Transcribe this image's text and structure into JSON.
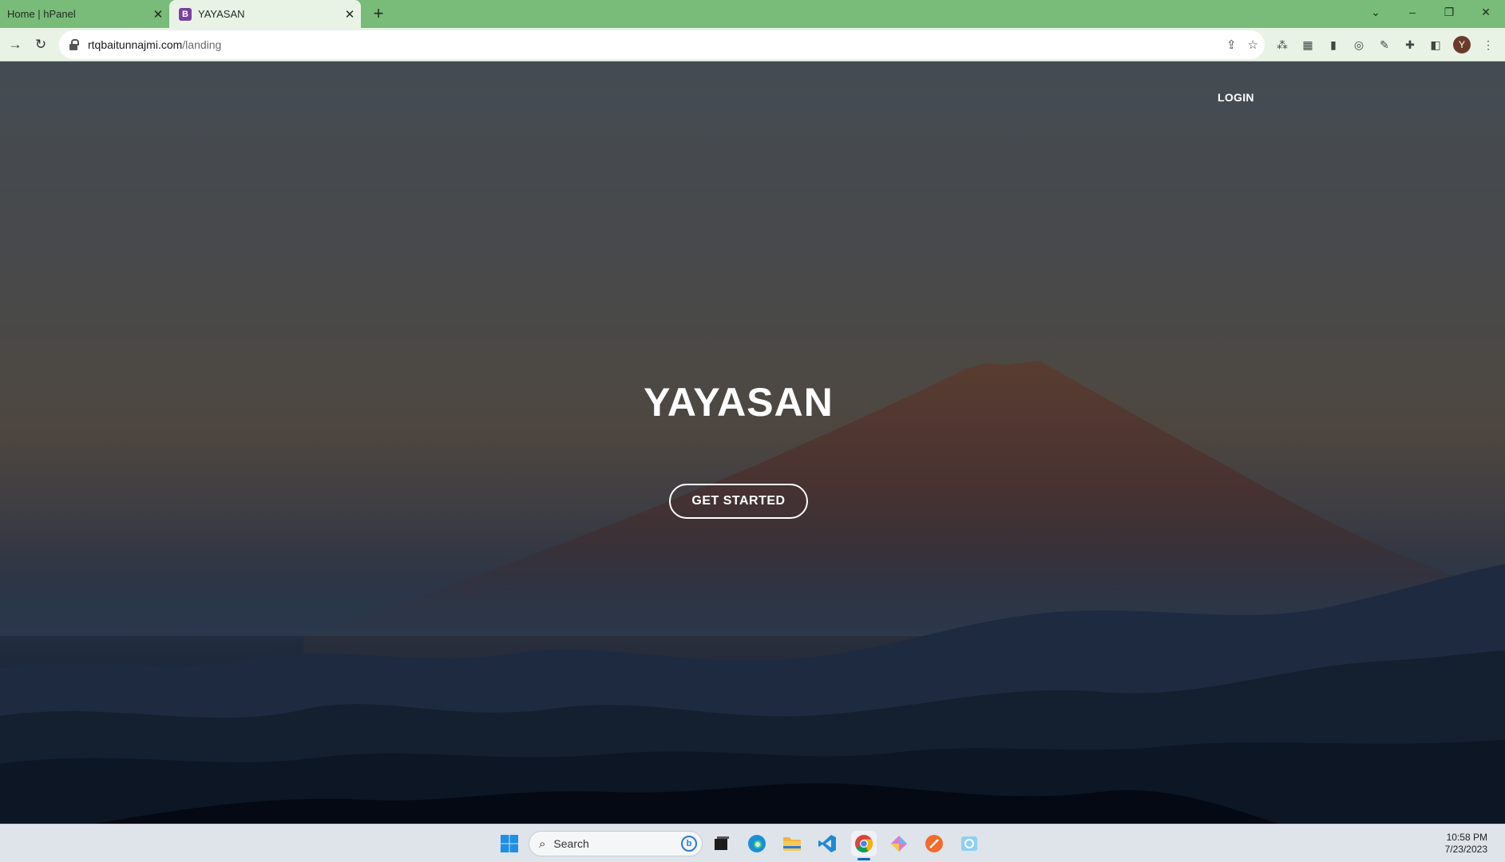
{
  "browser": {
    "tabs": [
      {
        "title": "Home | hPanel",
        "active": false
      },
      {
        "title": "YAYASAN",
        "active": true,
        "favicon": "B"
      }
    ],
    "close_glyph": "✕",
    "new_tab_glyph": "+",
    "url_host": "rtqbaitunnajmi.com",
    "url_path": "/landing",
    "profile_initial": "Y",
    "window_controls": {
      "dropdown": "⌄",
      "minimize": "–",
      "restore": "❐",
      "close": "✕"
    }
  },
  "page": {
    "nav": {
      "login": "LOGIN"
    },
    "hero": {
      "title": "YAYASAN",
      "cta": "GET STARTED"
    }
  },
  "taskbar": {
    "search_placeholder": "Search",
    "time": "10:58 PM",
    "date": "7/23/2023",
    "apps": [
      "windows-start",
      "task-view",
      "edge",
      "file-explorer",
      "vscode",
      "chrome",
      "app-diamond",
      "app-orange",
      "app-photo"
    ]
  }
}
